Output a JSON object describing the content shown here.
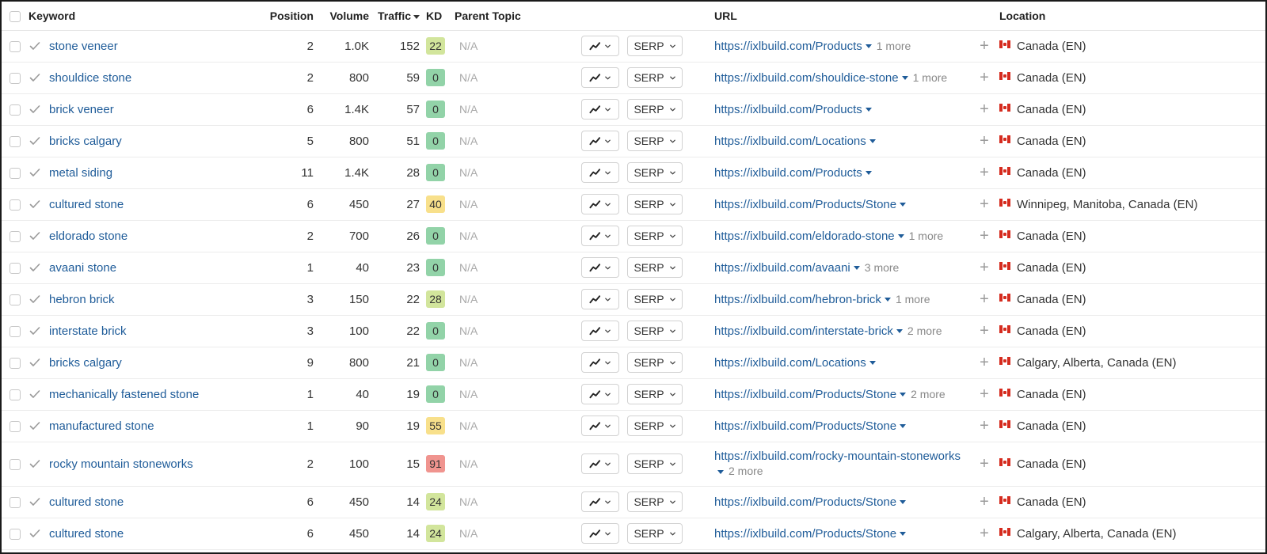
{
  "columns": {
    "keyword": "Keyword",
    "position": "Position",
    "volume": "Volume",
    "traffic": "Traffic",
    "kd": "KD",
    "parent_topic": "Parent Topic",
    "url": "URL",
    "location": "Location"
  },
  "labels": {
    "serp": "SERP",
    "na": "N/A"
  },
  "kd_colors": {
    "green": "#92d3a8",
    "light_green": "#d2e59c",
    "yellow": "#f8e08b",
    "red": "#f0948f"
  },
  "icons": {
    "row_check": "check-icon",
    "trend": "trend-line-icon",
    "dropdown": "chevron-down-icon",
    "url_dropdown": "caret-down-icon",
    "add": "plus-icon",
    "flag": "canada-flag-icon",
    "sort": "sort-desc-icon"
  },
  "rows": [
    {
      "keyword": "stone veneer",
      "position": "2",
      "volume": "1.0K",
      "traffic": "152",
      "kd": "22",
      "kd_color": "#d2e59c",
      "url": "https://ixlbuild.com/Products",
      "more": "1 more",
      "location": "Canada (EN)"
    },
    {
      "keyword": "shouldice stone",
      "position": "2",
      "volume": "800",
      "traffic": "59",
      "kd": "0",
      "kd_color": "#92d3a8",
      "url": "https://ixlbuild.com/shouldice-stone",
      "more": "1 more",
      "location": "Canada (EN)"
    },
    {
      "keyword": "brick veneer",
      "position": "6",
      "volume": "1.4K",
      "traffic": "57",
      "kd": "0",
      "kd_color": "#92d3a8",
      "url": "https://ixlbuild.com/Products",
      "more": "",
      "location": "Canada (EN)"
    },
    {
      "keyword": "bricks calgary",
      "position": "5",
      "volume": "800",
      "traffic": "51",
      "kd": "0",
      "kd_color": "#92d3a8",
      "url": "https://ixlbuild.com/Locations",
      "more": "",
      "location": "Canada (EN)"
    },
    {
      "keyword": "metal siding",
      "position": "11",
      "volume": "1.4K",
      "traffic": "28",
      "kd": "0",
      "kd_color": "#92d3a8",
      "url": "https://ixlbuild.com/Products",
      "more": "",
      "location": "Canada (EN)"
    },
    {
      "keyword": "cultured stone",
      "position": "6",
      "volume": "450",
      "traffic": "27",
      "kd": "40",
      "kd_color": "#f8e08b",
      "url": "https://ixlbuild.com/Products/Stone",
      "more": "",
      "location": "Winnipeg, Manitoba, Canada (EN)"
    },
    {
      "keyword": "eldorado stone",
      "position": "2",
      "volume": "700",
      "traffic": "26",
      "kd": "0",
      "kd_color": "#92d3a8",
      "url": "https://ixlbuild.com/eldorado-stone",
      "more": "1 more",
      "location": "Canada (EN)"
    },
    {
      "keyword": "avaani stone",
      "position": "1",
      "volume": "40",
      "traffic": "23",
      "kd": "0",
      "kd_color": "#92d3a8",
      "url": "https://ixlbuild.com/avaani",
      "more": "3 more",
      "location": "Canada (EN)"
    },
    {
      "keyword": "hebron brick",
      "position": "3",
      "volume": "150",
      "traffic": "22",
      "kd": "28",
      "kd_color": "#d2e59c",
      "url": "https://ixlbuild.com/hebron-brick",
      "more": "1 more",
      "location": "Canada (EN)"
    },
    {
      "keyword": "interstate brick",
      "position": "3",
      "volume": "100",
      "traffic": "22",
      "kd": "0",
      "kd_color": "#92d3a8",
      "url": "https://ixlbuild.com/interstate-brick",
      "more": "2 more",
      "location": "Canada (EN)"
    },
    {
      "keyword": "bricks calgary",
      "position": "9",
      "volume": "800",
      "traffic": "21",
      "kd": "0",
      "kd_color": "#92d3a8",
      "url": "https://ixlbuild.com/Locations",
      "more": "",
      "location": "Calgary, Alberta, Canada (EN)"
    },
    {
      "keyword": "mechanically fastened stone",
      "position": "1",
      "volume": "40",
      "traffic": "19",
      "kd": "0",
      "kd_color": "#92d3a8",
      "url": "https://ixlbuild.com/Products/Stone",
      "more": "2 more",
      "location": "Canada (EN)"
    },
    {
      "keyword": "manufactured stone",
      "position": "1",
      "volume": "90",
      "traffic": "19",
      "kd": "55",
      "kd_color": "#f8e08b",
      "url": "https://ixlbuild.com/Products/Stone",
      "more": "",
      "location": "Canada (EN)"
    },
    {
      "keyword": "rocky mountain stoneworks",
      "position": "2",
      "volume": "100",
      "traffic": "15",
      "kd": "91",
      "kd_color": "#f0948f",
      "url": "https://ixlbuild.com/rocky-mountain-stoneworks",
      "more": "2 more",
      "location": "Canada (EN)"
    },
    {
      "keyword": "cultured stone",
      "position": "6",
      "volume": "450",
      "traffic": "14",
      "kd": "24",
      "kd_color": "#d2e59c",
      "url": "https://ixlbuild.com/Products/Stone",
      "more": "",
      "location": "Canada (EN)"
    },
    {
      "keyword": "cultured stone",
      "position": "6",
      "volume": "450",
      "traffic": "14",
      "kd": "24",
      "kd_color": "#d2e59c",
      "url": "https://ixlbuild.com/Products/Stone",
      "more": "",
      "location": "Calgary, Alberta, Canada (EN)"
    }
  ]
}
